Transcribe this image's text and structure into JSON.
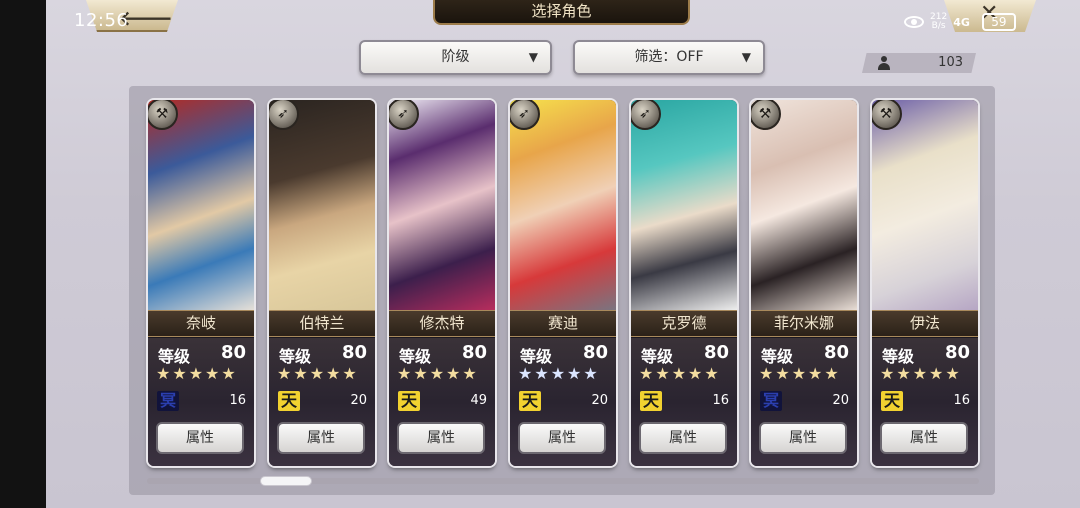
{
  "status_bar": {
    "time": "12:56",
    "net_speed_top": "212",
    "net_speed_bottom": "B/s",
    "signal_text": "4G",
    "battery": "59"
  },
  "header": {
    "title": "选择角色",
    "back_icon": "back-arrow-icon",
    "close_icon": "close-icon"
  },
  "filters": {
    "rank_label": "阶级",
    "filter_label": "筛选：OFF"
  },
  "count": "103",
  "cards": [
    {
      "name": "奈岐",
      "level_label": "等级",
      "level": "80",
      "stars": "★★★★★",
      "star_color": "#f3dda0",
      "element_char": "冥",
      "element_color": "#2b3fb0",
      "element_bg": "#11133b",
      "value": "16",
      "button": "属性",
      "type_char": "⚒",
      "portrait_bg": "linear-gradient(160deg,#b42a22 0%,#3b5a9a 30%,#e2c9a5 55%,#3a7ab8 75%,#e6e0d8 100%)"
    },
    {
      "name": "伯特兰",
      "level_label": "等级",
      "level": "80",
      "stars": "★★★★★",
      "star_color": "#f3dda0",
      "element_char": "天",
      "element_color": "#1b1b1b",
      "element_bg": "#f2d230",
      "value": "20",
      "button": "属性",
      "type_char": "➶",
      "portrait_bg": "linear-gradient(165deg,#2a2420 0%,#4a3a2e 35%,#c9a77f 55%,#e8d4a6 75%,#d8c79a 100%)"
    },
    {
      "name": "修杰特",
      "level_label": "等级",
      "level": "80",
      "stars": "★★★★★",
      "star_color": "#f3dda0",
      "element_char": "天",
      "element_color": "#1b1b1b",
      "element_bg": "#f2d230",
      "value": "49",
      "button": "属性",
      "type_char": "➶",
      "portrait_bg": "linear-gradient(160deg,#f1eef6 0%,#5a2d6e 25%,#e7c2c8 50%,#3c1f4c 75%,#b72d5d 100%)"
    },
    {
      "name": "赛迪",
      "level_label": "等级",
      "level": "80",
      "stars": "★★★★★",
      "star_color": "#dbe5ff",
      "element_char": "天",
      "element_color": "#1b1b1b",
      "element_bg": "#f2d230",
      "value": "20",
      "button": "属性",
      "type_char": "➶",
      "portrait_bg": "linear-gradient(160deg,#f6e24c 0%,#e8a54a 25%,#f0d0b6 50%,#d7393a 75%,#7a7480 100%)"
    },
    {
      "name": "克罗德",
      "level_label": "等级",
      "level": "80",
      "stars": "★★★★★",
      "star_color": "#f3dda0",
      "element_char": "天",
      "element_color": "#1b1b1b",
      "element_bg": "#f2d230",
      "value": "16",
      "button": "属性",
      "type_char": "➶",
      "portrait_bg": "linear-gradient(165deg,#2aa6a2 0%,#56c7c0 30%,#eadbc9 55%,#3a3a44 75%,#eeeeee 100%)"
    },
    {
      "name": "菲尔米娜",
      "level_label": "等级",
      "level": "80",
      "stars": "★★★★★",
      "star_color": "#f3dda0",
      "element_char": "冥",
      "element_color": "#2b3fb0",
      "element_bg": "#11133b",
      "value": "20",
      "button": "属性",
      "type_char": "⚒",
      "portrait_bg": "linear-gradient(160deg,#f0e4dc 0%,#d9bfb2 30%,#f5e8e0 50%,#2a2224 75%,#e9ded6 100%)"
    },
    {
      "name": "伊法",
      "level_label": "等级",
      "level": "80",
      "stars": "★★★★★",
      "star_color": "#f3dda0",
      "element_char": "天",
      "element_color": "#1b1b1b",
      "element_bg": "#f2d230",
      "value": "16",
      "button": "属性",
      "type_char": "⚒",
      "portrait_bg": "linear-gradient(160deg,#6b5ea8 0%,#e9e0c9 30%,#f3ece0 55%,#d7d2d8 80%,#b6a6c4 100%)"
    }
  ]
}
